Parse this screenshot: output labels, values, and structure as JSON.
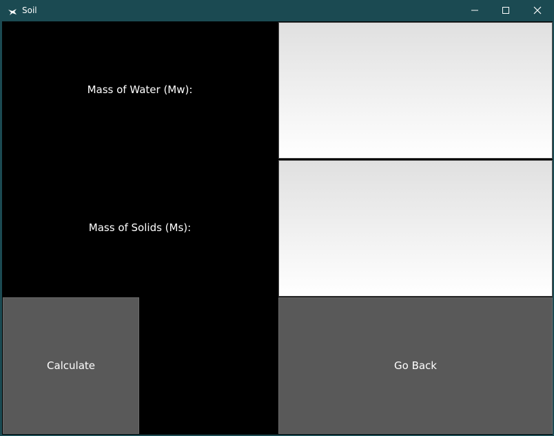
{
  "window": {
    "title": "Soil",
    "icon": "kivy-app-icon",
    "controls": {
      "minimize_icon": "minimize-icon",
      "maximize_icon": "maximize-icon",
      "close_icon": "close-icon"
    }
  },
  "form": {
    "water_label": "Mass of Water (Mw):",
    "water_value": "",
    "solids_label": "Mass of Solids (Ms):",
    "solids_value": ""
  },
  "buttons": {
    "calculate": "Calculate",
    "go_back": "Go Back"
  },
  "colors": {
    "titlebar": "#1b4a52",
    "background": "#000000",
    "button": "#595959",
    "text": "#ffffff"
  }
}
